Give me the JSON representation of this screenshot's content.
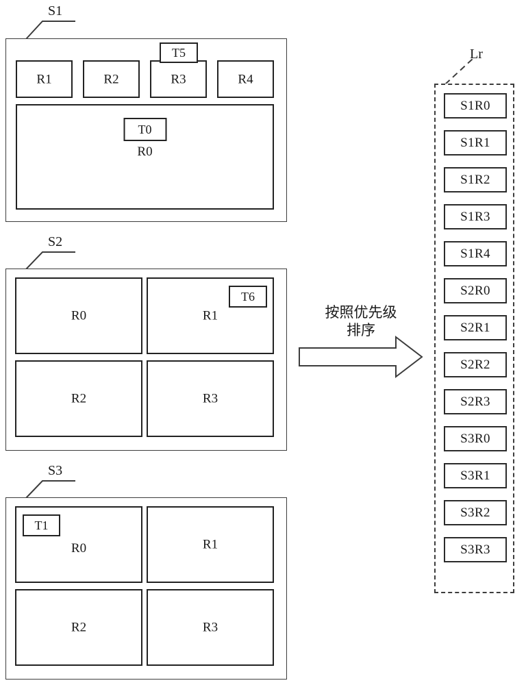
{
  "diagram": {
    "flow_annotation": "按照优先级\n排序",
    "arrow_icon": "right-arrow-outline-icon"
  },
  "screens": [
    {
      "id": "S1",
      "callout_label": "S1",
      "tags": [
        {
          "id": "T5",
          "label": "T5",
          "attached_to": "R3"
        },
        {
          "id": "T0",
          "label": "T0",
          "attached_to": "R0"
        }
      ],
      "regions": [
        {
          "id": "R1",
          "label": "R1"
        },
        {
          "id": "R2",
          "label": "R2"
        },
        {
          "id": "R3",
          "label": "R3"
        },
        {
          "id": "R4",
          "label": "R4"
        },
        {
          "id": "R0",
          "label": "R0"
        }
      ]
    },
    {
      "id": "S2",
      "callout_label": "S2",
      "tags": [
        {
          "id": "T6",
          "label": "T6",
          "attached_to": "R1"
        }
      ],
      "regions": [
        {
          "id": "R0",
          "label": "R0"
        },
        {
          "id": "R1",
          "label": "R1"
        },
        {
          "id": "R2",
          "label": "R2"
        },
        {
          "id": "R3",
          "label": "R3"
        }
      ]
    },
    {
      "id": "S3",
      "callout_label": "S3",
      "tags": [
        {
          "id": "T1",
          "label": "T1",
          "attached_to": "R0"
        }
      ],
      "regions": [
        {
          "id": "R0",
          "label": "R0"
        },
        {
          "id": "R1",
          "label": "R1"
        },
        {
          "id": "R2",
          "label": "R2"
        },
        {
          "id": "R3",
          "label": "R3"
        }
      ]
    }
  ],
  "result_list": {
    "callout_label": "Lr",
    "items": [
      {
        "label": "S1R0"
      },
      {
        "label": "S1R1"
      },
      {
        "label": "S1R2"
      },
      {
        "label": "S1R3"
      },
      {
        "label": "S1R4"
      },
      {
        "label": "S2R0"
      },
      {
        "label": "S2R1"
      },
      {
        "label": "S2R2"
      },
      {
        "label": "S2R3"
      },
      {
        "label": "S3R0"
      },
      {
        "label": "S3R1"
      },
      {
        "label": "S3R2"
      },
      {
        "label": "S3R3"
      }
    ]
  }
}
